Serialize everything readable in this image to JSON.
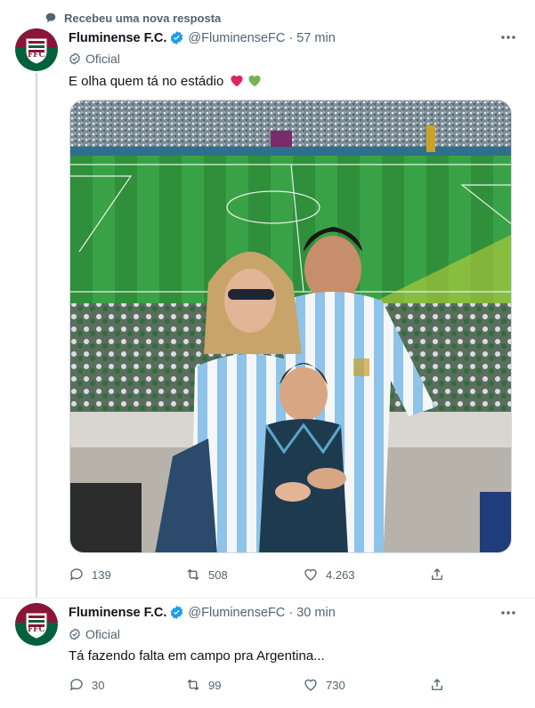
{
  "notification": {
    "text": "Recebeu uma nova resposta",
    "icon": "chat-bubble-icon"
  },
  "tweets": [
    {
      "name": "Fluminense F.C.",
      "handle": "@FluminenseFC",
      "separator": "·",
      "time": "57 min",
      "official_label": "Oficial",
      "text": "E olha quem tá no estádio",
      "emojis": [
        "red-heart-icon",
        "green-heart-icon"
      ],
      "media": "photo-family-at-stadium",
      "replies": "139",
      "retweets": "508",
      "likes": "4.263"
    },
    {
      "name": "Fluminense F.C.",
      "handle": "@FluminenseFC",
      "separator": "·",
      "time": "30 min",
      "official_label": "Oficial",
      "text": "Tá fazendo falta em campo pra Argentina...",
      "replies": "30",
      "retweets": "99",
      "likes": "730"
    }
  ],
  "colors": {
    "verified": "#1d9bf0",
    "muted": "#536471",
    "text": "#0f1419",
    "fluminense_red": "#8a1538",
    "fluminense_green": "#00613c"
  }
}
